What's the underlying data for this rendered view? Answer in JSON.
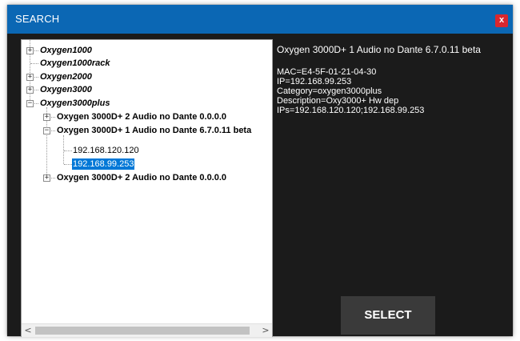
{
  "window": {
    "title": "SEARCH",
    "close_label": "x"
  },
  "tree": {
    "nodes": [
      {
        "label": "Oxygen1000"
      },
      {
        "label": "Oxygen1000rack"
      },
      {
        "label": "Oxygen2000"
      },
      {
        "label": "Oxygen3000"
      },
      {
        "label": "Oxygen3000plus"
      },
      {
        "label": "Oxygen 3000D+ 2 Audio no Dante 0.0.0.0"
      },
      {
        "label": "Oxygen 3000D+ 1 Audio no Dante 6.7.0.11 beta"
      },
      {
        "label": "192.168.120.120"
      },
      {
        "label": "192.168.99.253"
      },
      {
        "label": "Oxygen 3000D+ 2 Audio no Dante 0.0.0.0"
      }
    ],
    "expand_plus": "+",
    "expand_minus": "−",
    "scroll_left": "<",
    "scroll_right": ">"
  },
  "details": {
    "heading": "Oxygen 3000D+ 1 Audio no Dante 6.7.0.11 beta",
    "lines": [
      "MAC=E4-5F-01-21-04-30",
      "IP=192.168.99.253",
      "Category=oxygen3000plus",
      "Description=Oxy3000+ Hw dep",
      "IPs=192.168.120.120;192.168.99.253"
    ]
  },
  "select_button": {
    "label": "SELECT"
  },
  "colors": {
    "titlebar": "#0b67b4",
    "close": "#d9272e",
    "background": "#1b1b1b",
    "selection": "#0078d7",
    "button": "#3a3a3a"
  }
}
